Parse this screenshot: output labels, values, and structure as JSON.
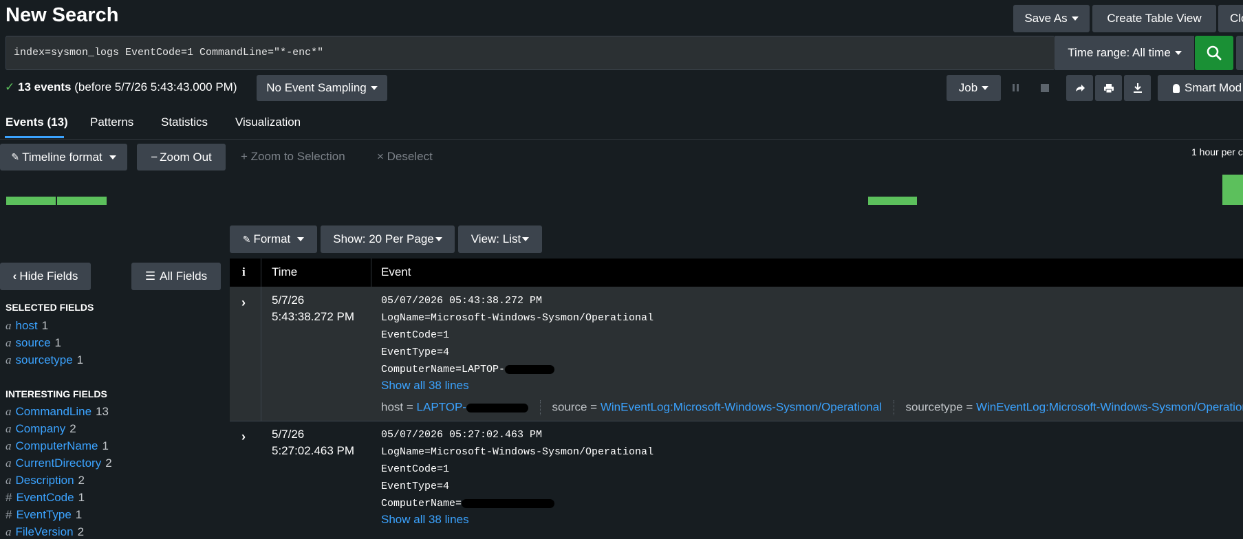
{
  "header": {
    "title": "New Search",
    "save_as": "Save As",
    "create_table_view": "Create Table View",
    "close": "Clo"
  },
  "search": {
    "query": "index=sysmon_logs EventCode=1 CommandLine=\"*-enc*\"",
    "time_range": "Time range: All time"
  },
  "status": {
    "events_count": "13 events",
    "before_text": "(before 5/7/26 5:43:43.000 PM)",
    "sampling": "No Event Sampling",
    "job": "Job",
    "smart_mode": "Smart Mod"
  },
  "tabs": [
    {
      "label": "Events (13)",
      "active": true
    },
    {
      "label": "Patterns"
    },
    {
      "label": "Statistics"
    },
    {
      "label": "Visualization"
    }
  ],
  "timeline": {
    "format": "Timeline format",
    "zoom_out": "Zoom Out",
    "zoom_to_selection": "Zoom to Selection",
    "deselect": "Deselect",
    "scale": "1 hour per c"
  },
  "results_toolbar": {
    "format": "Format",
    "per_page": "Show: 20 Per Page",
    "view": "View: List"
  },
  "sidebar": {
    "hide_fields": "Hide Fields",
    "all_fields": "All Fields",
    "selected_heading": "SELECTED FIELDS",
    "selected": [
      {
        "type": "a",
        "name": "host",
        "count": "1"
      },
      {
        "type": "a",
        "name": "source",
        "count": "1"
      },
      {
        "type": "a",
        "name": "sourcetype",
        "count": "1"
      }
    ],
    "interesting_heading": "INTERESTING FIELDS",
    "interesting": [
      {
        "type": "a",
        "name": "CommandLine",
        "count": "13"
      },
      {
        "type": "a",
        "name": "Company",
        "count": "2"
      },
      {
        "type": "a",
        "name": "ComputerName",
        "count": "1"
      },
      {
        "type": "a",
        "name": "CurrentDirectory",
        "count": "2"
      },
      {
        "type": "a",
        "name": "Description",
        "count": "2"
      },
      {
        "type": "#",
        "name": "EventCode",
        "count": "1"
      },
      {
        "type": "#",
        "name": "EventType",
        "count": "1"
      },
      {
        "type": "a",
        "name": "FileVersion",
        "count": "2"
      }
    ]
  },
  "table": {
    "col_info": "i",
    "col_time": "Time",
    "col_event": "Event"
  },
  "events": [
    {
      "date": "5/7/26",
      "time": "5:43:38.272 PM",
      "line1": "05/07/2026 05:43:38.272 PM",
      "line2": "LogName=Microsoft-Windows-Sysmon/Operational",
      "line3": "EventCode=1",
      "line4": "EventType=4",
      "line5": "ComputerName=LAPTOP-",
      "show_all": "Show all 38 lines",
      "host_label": "host =",
      "host_value": "LAPTOP-",
      "source_label": "source =",
      "source_value": "WinEventLog:Microsoft-Windows-Sysmon/Operational",
      "sourcetype_label": "sourcetype =",
      "sourcetype_value": "WinEventLog:Microsoft-Windows-Sysmon/Operation"
    },
    {
      "date": "5/7/26",
      "time": "5:27:02.463 PM",
      "line1": "05/07/2026 05:27:02.463 PM",
      "line2": "LogName=Microsoft-Windows-Sysmon/Operational",
      "line3": "EventCode=1",
      "line4": "EventType=4",
      "line5": "ComputerName=",
      "show_all": "Show all 38 lines"
    }
  ],
  "colors": {
    "accent": "#3ba3ff",
    "success": "#1a9035",
    "timeline_bar": "#5cc05c"
  }
}
